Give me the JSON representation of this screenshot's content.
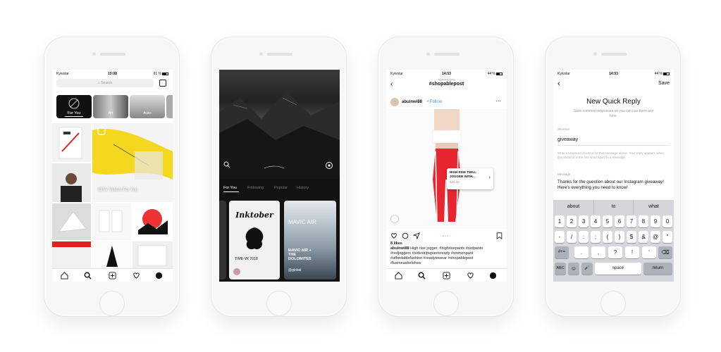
{
  "colors": {
    "accent": "#ff3b30",
    "igtv_yellow": "#f4d81f",
    "link": "#3897f0"
  },
  "status": {
    "carrier": "Kyivstar",
    "time1": "15:08",
    "time2": "14:53",
    "battery1": "61 %",
    "battery2": "44 %"
  },
  "explore": {
    "search_placeholder": "Search",
    "chips": [
      "For You",
      "Art",
      "Auto"
    ],
    "igtv_banner": "IGTV Videos For You",
    "tabs": [
      "home-icon",
      "search-icon",
      "add-icon",
      "heart-icon",
      "profile-icon"
    ]
  },
  "igtv": {
    "tabs": [
      "For You",
      "Following",
      "Popular",
      "History"
    ],
    "cards": [
      {
        "title": "Inktober",
        "subtitle": "TIME-VK 2018"
      },
      {
        "title": "MAVIC AIR",
        "subtitle": "MAVIC AIR + THE DOLOMITES",
        "user": "@global"
      }
    ]
  },
  "post": {
    "top_label": "TOP POSTS",
    "hashtag": "#shopablepost",
    "username": "abuinwi88",
    "follow": "Follow",
    "tag_title": "HIGH RISE TWILL JOGGER WITH...",
    "tag_price": "$20.00",
    "likes": "8 likes",
    "caption_user": "abuinwi88",
    "caption_text": "High rise jogger. #highrisepants #redpants #redjoggers #sidestripepantsready #womenpant #affordablefashion #readytowear #shopablepost #luxmeasketshoo"
  },
  "quick_reply": {
    "back": "‹",
    "save": "Save",
    "title": "New Quick Reply",
    "subtitle": "Save common responses so you can use them any time.",
    "shortcut_label": "Shortcut",
    "shortcut_value": "giveaway",
    "shortcut_help": "Write a keyboard shortcut for this message above. Your reply appears when this shortcut is the first word typed in a message.",
    "message_label": "Message",
    "message_value": "Thanks for the question about our Instagram giveaway! Here's everything you need to know!",
    "suggestions": [
      "about",
      "to",
      "what"
    ],
    "row1": [
      "1",
      "2",
      "3",
      "4",
      "5",
      "6",
      "7",
      "8",
      "9",
      "0"
    ],
    "row2": [
      "-",
      "/",
      ":",
      ";",
      "(",
      ")",
      "$",
      "&",
      "@",
      "\""
    ],
    "row3": [
      "#+=",
      ".",
      ",",
      "?",
      "!",
      "'",
      "⌫"
    ],
    "row4": [
      "ABC",
      "☺",
      "🎤",
      "space",
      "return"
    ]
  }
}
